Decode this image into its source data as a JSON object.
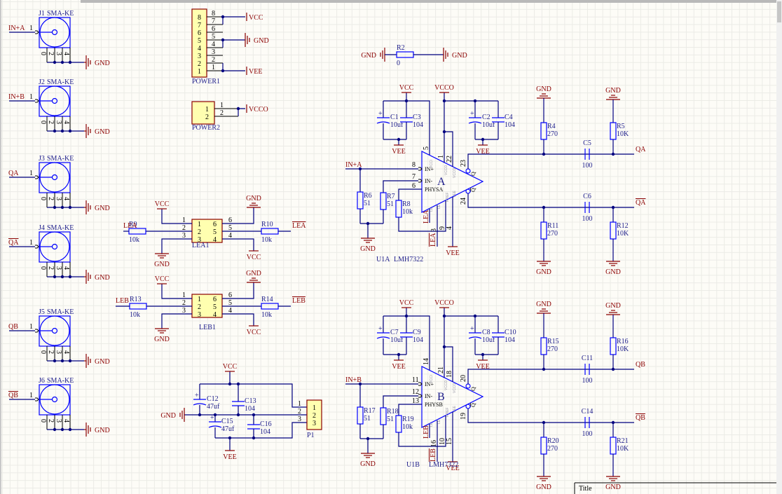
{
  "colors": {
    "wire": "#000080",
    "component_outline": "#0000ff",
    "designator": "#1c1c8a",
    "net_label": "#8b0000",
    "pin": "#000000",
    "part_body": "#ffffb0",
    "part_border": "#8b0000",
    "sheet": "#fdfcf7",
    "grid": "#ebebe6"
  },
  "connectors": [
    {
      "designator": "J1",
      "comment": "SMA-KE",
      "pin": "1",
      "net": "IN+A",
      "net_inverted": false,
      "shield_pins": [
        "0",
        "2",
        "3",
        "4"
      ],
      "ground": "GND"
    },
    {
      "designator": "J2",
      "comment": "SMA-KE",
      "pin": "1",
      "net": "IN+B",
      "net_inverted": false,
      "shield_pins": [
        "0",
        "2",
        "3",
        "4"
      ],
      "ground": "GND"
    },
    {
      "designator": "J3",
      "comment": "SMA-KE",
      "pin": "1",
      "net": "QA",
      "net_inverted": false,
      "shield_pins": [
        "0",
        "2",
        "3",
        "4"
      ],
      "ground": "GND"
    },
    {
      "designator": "J4",
      "comment": "SMA-KE",
      "pin": "1",
      "net": "QA",
      "net_inverted": true,
      "shield_pins": [
        "0",
        "2",
        "3",
        "4"
      ],
      "ground": "GND"
    },
    {
      "designator": "J5",
      "comment": "SMA-KE",
      "pin": "1",
      "net": "QB",
      "net_inverted": false,
      "shield_pins": [
        "0",
        "2",
        "3",
        "4"
      ],
      "ground": "GND"
    },
    {
      "designator": "J6",
      "comment": "SMA-KE",
      "pin": "1",
      "net": "QB",
      "net_inverted": true,
      "shield_pins": [
        "0",
        "2",
        "3",
        "4"
      ],
      "ground": "GND"
    }
  ],
  "power1": {
    "designator": "POWER1",
    "pins": [
      "8",
      "7",
      "6",
      "5",
      "4",
      "3",
      "2",
      "1"
    ],
    "nets": [
      "VCC",
      "GND",
      "VEE"
    ]
  },
  "power2": {
    "designator": "POWER2",
    "pins": [
      "1",
      "2"
    ],
    "net": "VCCO"
  },
  "r2": {
    "designator": "R2",
    "value": "0",
    "nets": [
      "GND",
      "GND"
    ]
  },
  "buffers": [
    {
      "designator": "LEA1",
      "left_pins": [
        "1",
        "2",
        "3"
      ],
      "right_pins": [
        "6",
        "5",
        "4"
      ],
      "in_net": "LEA",
      "out_net": "LEA",
      "r_in": {
        "designator": "R9",
        "value": "10k"
      },
      "r_out": {
        "designator": "R10",
        "value": "10k"
      },
      "left_top": "VCC",
      "left_bottom": "GND",
      "right_top": "GND",
      "right_bottom": "VCC"
    },
    {
      "designator": "LEB1",
      "left_pins": [
        "1",
        "2",
        "3"
      ],
      "right_pins": [
        "6",
        "5",
        "4"
      ],
      "in_net": "LEB",
      "out_net": "LEB",
      "r_in": {
        "designator": "R13",
        "value": "10k"
      },
      "r_out": {
        "designator": "R14",
        "value": "10k"
      },
      "left_top": "VCC",
      "left_bottom": "GND",
      "right_top": "GND",
      "right_bottom": "VCC"
    }
  ],
  "decoupling": {
    "vcc": "VCC",
    "vee": "VEE",
    "gnd": "GND",
    "caps": [
      {
        "designator": "C12",
        "value": "47uf",
        "polarized": true
      },
      {
        "designator": "C13",
        "value": "104",
        "polarized": false
      },
      {
        "designator": "C15",
        "value": "47uf",
        "polarized": true
      },
      {
        "designator": "C16",
        "value": "104",
        "polarized": false
      }
    ],
    "connector": {
      "designator": "P1",
      "pins": [
        "1",
        "2",
        "3"
      ]
    }
  },
  "comparators": [
    {
      "unit_letter": "A",
      "designator": "U1A",
      "part": "LMH7322",
      "pin_names": {
        "in_p": "IN+",
        "in_n": "IN-",
        "hys": "PHYSA",
        "vcci": "VCCI",
        "vcco": "VCCO",
        "rref": "RREF",
        "vee": "VEE",
        "le": "LE",
        "q": "Q"
      },
      "pins": {
        "vcc": "5",
        "vcco1": "1",
        "vcco2": "22",
        "in_p": "8",
        "in_n": "7",
        "hys": "6",
        "le": "3",
        "rref": "9",
        "vee": "4",
        "q": "23",
        "q_bar": "24"
      },
      "nets": {
        "vcc": "VCC",
        "vcco": "VCCO",
        "vee": "VEE",
        "gnd": "GND",
        "in": "IN+A",
        "le": "LEA",
        "le_bar": "LEA",
        "q": "QA",
        "q_bar": "QA"
      },
      "parts": {
        "c_vcc_pol": {
          "designator": "C1",
          "value": "10uf"
        },
        "c_vcc": {
          "designator": "C3",
          "value": "104"
        },
        "c_vcco_pol": {
          "designator": "C2",
          "value": "10uf"
        },
        "c_vcco": {
          "designator": "C4",
          "value": "104"
        },
        "r_inp": {
          "designator": "R6",
          "value": "51"
        },
        "r_inn": {
          "designator": "R7",
          "value": "51"
        },
        "r_hys": {
          "designator": "R8",
          "value": "10k"
        },
        "r_pull_q": {
          "designator": "R4",
          "value": "270"
        },
        "r_term_q": {
          "designator": "R5",
          "value": "10K"
        },
        "c_q": {
          "designator": "C5",
          "value": "100"
        },
        "r_pull_qb": {
          "designator": "R11",
          "value": "270"
        },
        "r_term_qb": {
          "designator": "R12",
          "value": "10K"
        },
        "c_qb": {
          "designator": "C6",
          "value": "100"
        }
      }
    },
    {
      "unit_letter": "B",
      "designator": "U1B",
      "part": "LMH7322",
      "pin_names": {
        "in_p": "IN+",
        "in_n": "IN-",
        "hys": "PHYSB",
        "vcci": "VCCI",
        "vcco": "VCCO",
        "rref": "RREF",
        "vee": "VEE",
        "le": "LE",
        "q": "Q"
      },
      "pins": {
        "vcc": "14",
        "vcco1": "21",
        "vcco2": "18",
        "in_p": "11",
        "in_n": "12",
        "hys": "13",
        "le": "16",
        "rref": "10",
        "vee": "15",
        "q": "20",
        "q_bar": "19"
      },
      "nets": {
        "vcc": "VCC",
        "vcco": "VCCO",
        "vee": "VEE",
        "gnd": "GND",
        "in": "IN+B",
        "le": "LEB",
        "le_bar": "LEB",
        "q": "QB",
        "q_bar": "QB"
      },
      "parts": {
        "c_vcc_pol": {
          "designator": "C7",
          "value": "10uf"
        },
        "c_vcc": {
          "designator": "C9",
          "value": "104"
        },
        "c_vcco_pol": {
          "designator": "C8",
          "value": "10uf"
        },
        "c_vcco": {
          "designator": "C10",
          "value": "104"
        },
        "r_inp": {
          "designator": "R17",
          "value": "51"
        },
        "r_inn": {
          "designator": "R18",
          "value": "51"
        },
        "r_hys": {
          "designator": "R19",
          "value": "10k"
        },
        "r_pull_q": {
          "designator": "R15",
          "value": "270"
        },
        "r_term_q": {
          "designator": "R16",
          "value": "10K"
        },
        "c_q": {
          "designator": "C11",
          "value": "100"
        },
        "r_pull_qb": {
          "designator": "R20",
          "value": "270"
        },
        "r_term_qb": {
          "designator": "R21",
          "value": "10K"
        },
        "c_qb": {
          "designator": "C14",
          "value": "100"
        }
      }
    }
  ],
  "title_block": {
    "label": "Title"
  }
}
